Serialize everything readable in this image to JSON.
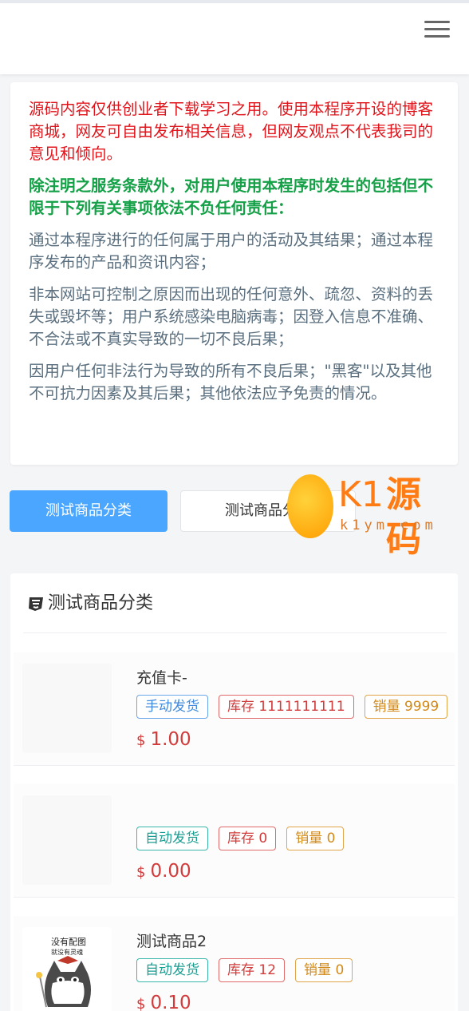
{
  "header": {
    "menu_icon": "hamburger-icon"
  },
  "notice": {
    "paragraphs": [
      "源码内容仅供创业者下载学习之用。使用本程序开设的博客商城，网友可自由发布相关信息，但网友观点不代表我司的意见和倾向。",
      "除注明之服务条款外，对用户使用本程序时发生的包括但不限于下列有关事项依法不负任何责任：",
      "通过本程序进行的任何属于用户的活动及其结果；通过本程序发布的产品和资讯内容；",
      "非本网站可控制之原因而出现的任何意外、疏忽、资料的丢失或毁坏等；用户系统感染电脑病毒；因登入信息不准确、不合法或不真实导致的一切不良后果；",
      "因用户任何非法行为导致的所有不良后果；\"黑客\"以及其他不可抗力因素及其后果；其他依法应予免责的情况。"
    ]
  },
  "tabs": [
    {
      "label": "测试商品分类",
      "active": true
    },
    {
      "label": "测试商品分类"
    }
  ],
  "watermark": {
    "brand_k": "K1",
    "brand_cn": "源码",
    "url": "k1ym.com"
  },
  "category": {
    "icon": "css3-icon",
    "title": "测试商品分类",
    "items": [
      {
        "name": "充值卡-",
        "delivery": "手动发货",
        "stock": "库存 1111111111",
        "sales": "销量 9999",
        "currency": "$",
        "price": "1.00"
      },
      {
        "name": "",
        "delivery": "自动发货",
        "stock": "库存 0",
        "sales": "销量 0",
        "currency": "$",
        "price": "0.00"
      },
      {
        "name": "测试商品2",
        "delivery": "自动发货",
        "stock": "库存 12",
        "sales": "销量 0",
        "currency": "$",
        "price": "0.10",
        "thumb_caption": "没有配图 就没有灵魂"
      }
    ]
  },
  "colors": {
    "accent": "#4aa6ff",
    "price": "#d23b3b",
    "notice_red": "#e0141b",
    "notice_green": "#14a046"
  }
}
